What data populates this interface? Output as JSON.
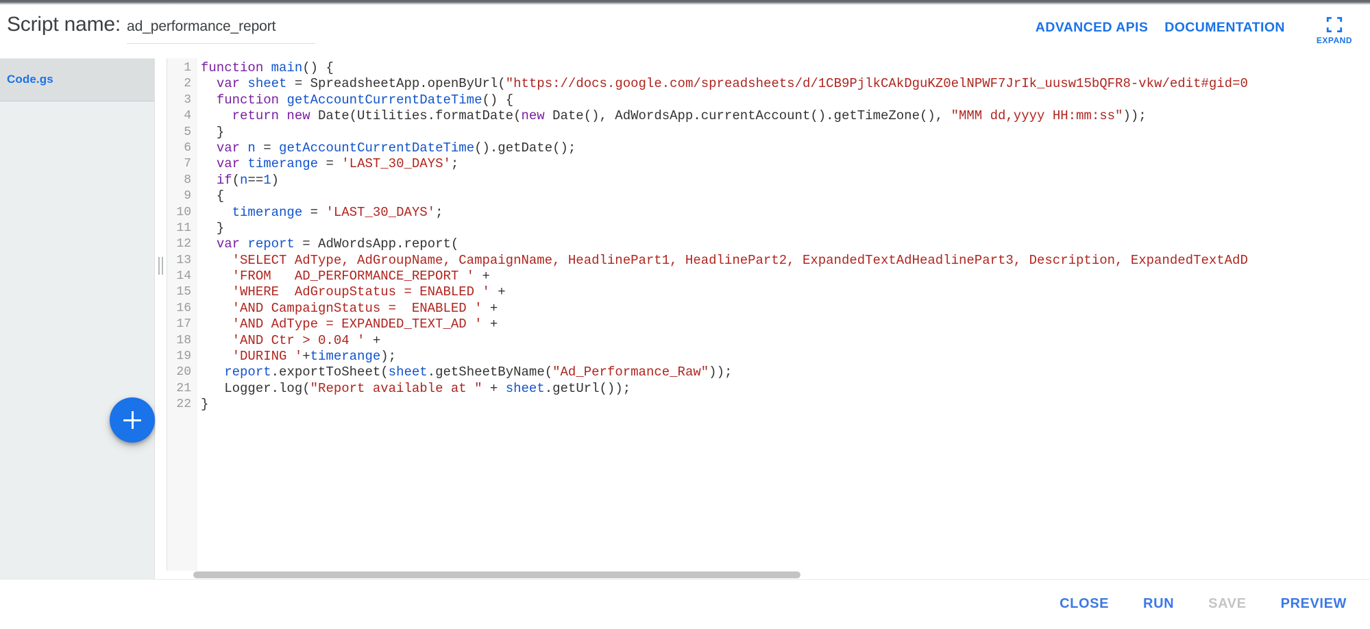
{
  "header": {
    "script_name_label": "Script name:",
    "script_name_value": "ad_performance_report",
    "advanced_apis_label": "ADVANCED APIS",
    "documentation_label": "DOCUMENTATION",
    "expand_label": "EXPAND"
  },
  "sidebar": {
    "files": [
      {
        "name": "Code.gs",
        "selected": true
      }
    ],
    "add_file_label": "+"
  },
  "editor": {
    "lines": [
      {
        "n": "1",
        "tokens": [
          {
            "t": "function ",
            "c": "kw"
          },
          {
            "t": "main",
            "c": "id"
          },
          {
            "t": "() {",
            "c": "pl"
          }
        ]
      },
      {
        "n": "2",
        "tokens": [
          {
            "t": "  ",
            "c": "pl"
          },
          {
            "t": "var ",
            "c": "kw"
          },
          {
            "t": "sheet",
            "c": "id"
          },
          {
            "t": " = SpreadsheetApp.openByUrl(",
            "c": "pl"
          },
          {
            "t": "\"https://docs.google.com/spreadsheets/d/1CB9PjlkCAkDguKZ0elNPWF7JrIk_uusw15bQFR8-vkw/edit#gid=0",
            "c": "str"
          }
        ]
      },
      {
        "n": "3",
        "tokens": [
          {
            "t": "  ",
            "c": "pl"
          },
          {
            "t": "function ",
            "c": "kw"
          },
          {
            "t": "getAccountCurrentDateTime",
            "c": "id"
          },
          {
            "t": "() {",
            "c": "pl"
          }
        ]
      },
      {
        "n": "4",
        "tokens": [
          {
            "t": "    ",
            "c": "pl"
          },
          {
            "t": "return new ",
            "c": "kw"
          },
          {
            "t": "Date(Utilities.formatDate(",
            "c": "pl"
          },
          {
            "t": "new ",
            "c": "kw"
          },
          {
            "t": "Date(), AdWordsApp.currentAccount().getTimeZone(), ",
            "c": "pl"
          },
          {
            "t": "\"MMM dd,yyyy HH:mm:ss\"",
            "c": "str"
          },
          {
            "t": "));",
            "c": "pl"
          }
        ]
      },
      {
        "n": "5",
        "tokens": [
          {
            "t": "  }",
            "c": "pl"
          }
        ]
      },
      {
        "n": "6",
        "tokens": [
          {
            "t": "  ",
            "c": "pl"
          },
          {
            "t": "var ",
            "c": "kw"
          },
          {
            "t": "n",
            "c": "id"
          },
          {
            "t": " = ",
            "c": "pl"
          },
          {
            "t": "getAccountCurrentDateTime",
            "c": "id"
          },
          {
            "t": "().getDate();",
            "c": "pl"
          }
        ]
      },
      {
        "n": "7",
        "tokens": [
          {
            "t": "  ",
            "c": "pl"
          },
          {
            "t": "var ",
            "c": "kw"
          },
          {
            "t": "timerange",
            "c": "id"
          },
          {
            "t": " = ",
            "c": "pl"
          },
          {
            "t": "'LAST_30_DAYS'",
            "c": "str"
          },
          {
            "t": ";",
            "c": "pl"
          }
        ]
      },
      {
        "n": "8",
        "tokens": [
          {
            "t": "  ",
            "c": "pl"
          },
          {
            "t": "if",
            "c": "kw"
          },
          {
            "t": "(",
            "c": "pl"
          },
          {
            "t": "n",
            "c": "id"
          },
          {
            "t": "==",
            "c": "pl"
          },
          {
            "t": "1",
            "c": "num"
          },
          {
            "t": ")",
            "c": "pl"
          }
        ]
      },
      {
        "n": "9",
        "tokens": [
          {
            "t": "  {",
            "c": "pl"
          }
        ]
      },
      {
        "n": "10",
        "tokens": [
          {
            "t": "    ",
            "c": "pl"
          },
          {
            "t": "timerange",
            "c": "id"
          },
          {
            "t": " = ",
            "c": "pl"
          },
          {
            "t": "'LAST_30_DAYS'",
            "c": "str"
          },
          {
            "t": ";",
            "c": "pl"
          }
        ]
      },
      {
        "n": "11",
        "tokens": [
          {
            "t": "  }",
            "c": "pl"
          }
        ]
      },
      {
        "n": "12",
        "tokens": [
          {
            "t": "  ",
            "c": "pl"
          },
          {
            "t": "var ",
            "c": "kw"
          },
          {
            "t": "report",
            "c": "id"
          },
          {
            "t": " = AdWordsApp.report(",
            "c": "pl"
          }
        ]
      },
      {
        "n": "13",
        "tokens": [
          {
            "t": "    ",
            "c": "pl"
          },
          {
            "t": "'SELECT AdType, AdGroupName, CampaignName, HeadlinePart1, HeadlinePart2, ExpandedTextAdHeadlinePart3, Description, ExpandedTextAdD",
            "c": "str"
          }
        ]
      },
      {
        "n": "14",
        "tokens": [
          {
            "t": "    ",
            "c": "pl"
          },
          {
            "t": "'FROM   AD_PERFORMANCE_REPORT '",
            "c": "str"
          },
          {
            "t": " +",
            "c": "pl"
          }
        ]
      },
      {
        "n": "15",
        "tokens": [
          {
            "t": "    ",
            "c": "pl"
          },
          {
            "t": "'WHERE  AdGroupStatus = ENABLED '",
            "c": "str"
          },
          {
            "t": " +",
            "c": "pl"
          }
        ]
      },
      {
        "n": "16",
        "tokens": [
          {
            "t": "    ",
            "c": "pl"
          },
          {
            "t": "'AND CampaignStatus =  ENABLED '",
            "c": "str"
          },
          {
            "t": " +",
            "c": "pl"
          }
        ]
      },
      {
        "n": "17",
        "tokens": [
          {
            "t": "    ",
            "c": "pl"
          },
          {
            "t": "'AND AdType = EXPANDED_TEXT_AD '",
            "c": "str"
          },
          {
            "t": " +",
            "c": "pl"
          }
        ]
      },
      {
        "n": "18",
        "tokens": [
          {
            "t": "    ",
            "c": "pl"
          },
          {
            "t": "'AND Ctr > 0.04 '",
            "c": "str"
          },
          {
            "t": " +",
            "c": "pl"
          }
        ]
      },
      {
        "n": "19",
        "tokens": [
          {
            "t": "    ",
            "c": "pl"
          },
          {
            "t": "'DURING '",
            "c": "str"
          },
          {
            "t": "+",
            "c": "pl"
          },
          {
            "t": "timerange",
            "c": "id"
          },
          {
            "t": ");",
            "c": "pl"
          }
        ]
      },
      {
        "n": "20",
        "tokens": [
          {
            "t": "   ",
            "c": "pl"
          },
          {
            "t": "report",
            "c": "id"
          },
          {
            "t": ".exportToSheet(",
            "c": "pl"
          },
          {
            "t": "sheet",
            "c": "id"
          },
          {
            "t": ".getSheetByName(",
            "c": "pl"
          },
          {
            "t": "\"Ad_Performance_Raw\"",
            "c": "str"
          },
          {
            "t": "));",
            "c": "pl"
          }
        ]
      },
      {
        "n": "21",
        "tokens": [
          {
            "t": "   Logger.log(",
            "c": "pl"
          },
          {
            "t": "\"Report available at \"",
            "c": "str"
          },
          {
            "t": " + ",
            "c": "pl"
          },
          {
            "t": "sheet",
            "c": "id"
          },
          {
            "t": ".getUrl());",
            "c": "pl"
          }
        ]
      },
      {
        "n": "22",
        "tokens": [
          {
            "t": "}",
            "c": "pl"
          }
        ]
      }
    ]
  },
  "footer": {
    "buttons": [
      {
        "label": "CLOSE",
        "disabled": false
      },
      {
        "label": "RUN",
        "disabled": false
      },
      {
        "label": "SAVE",
        "disabled": true
      },
      {
        "label": "PREVIEW",
        "disabled": false
      }
    ]
  },
  "colors": {
    "accent_blue": "#1a73e8",
    "link_blue": "#3b78e7",
    "disabled_grey": "#c2c4c6",
    "keyword_purple": "#7a1ea1",
    "string_red": "#b0251f",
    "identifier_blue": "#1154cc"
  }
}
